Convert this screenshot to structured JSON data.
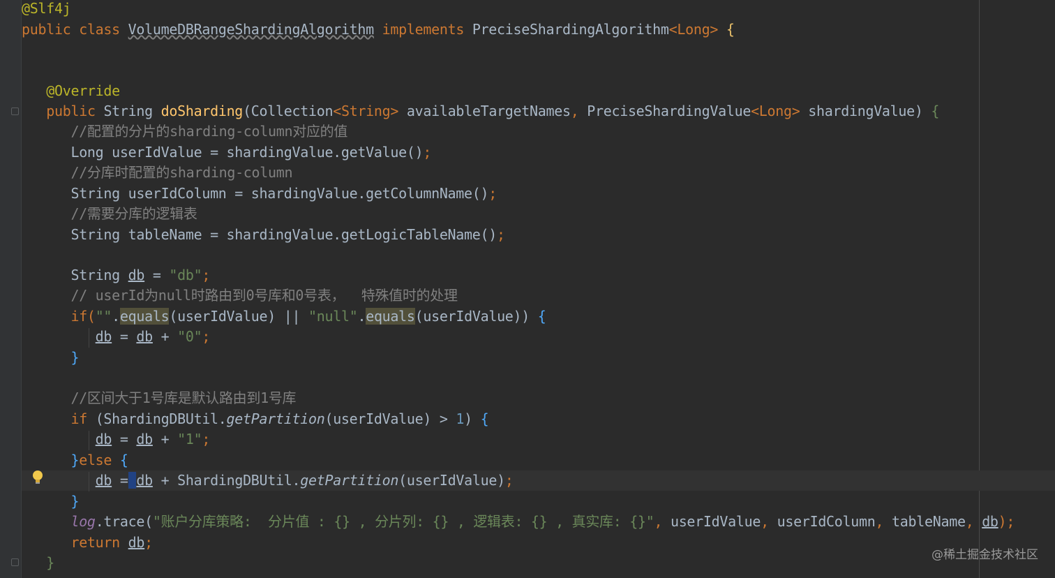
{
  "editor": {
    "theme": "darcula",
    "colors": {
      "background": "#2b2b2b",
      "keyword": "#cc7832",
      "annotation": "#bbb529",
      "string": "#6a8759",
      "number": "#6897bb",
      "comment": "#808080",
      "method": "#ffc66d",
      "text": "#a9b7c6"
    },
    "code": {
      "l1_annotation": "@Slf4j",
      "l2_public": "public",
      "l2_class": "class",
      "l2_classname": "VolumeDBRangeShardingAlgorithm",
      "l2_implements": "implements",
      "l2_iface": "PreciseShardingAlgorithm",
      "l2_generic": "<Long>",
      "l2_brace": "{",
      "l3_override": "@Override",
      "l4_public": "public",
      "l4_type": "String",
      "l4_method": "doSharding",
      "l4_p1": "(Collection",
      "l4_p1gen": "<String>",
      "l4_p1name": "availableTargetNames",
      "l4_comma": ",",
      "l4_p2": "PreciseShardingValue",
      "l4_p2gen": "<Long>",
      "l4_p2name": "shardingValue)",
      "l4_brace": "{",
      "c1": "//配置的分片的sharding-column对应的值",
      "l5_type": "Long",
      "l5_rest": "userIdValue = shardingValue.getValue()",
      "c2": "//分库时配置的sharding-column",
      "l6_type": "String",
      "l6_rest": "userIdColumn = shardingValue.getColumnName()",
      "c3": "//需要分库的逻辑表",
      "l7_type": "String",
      "l7_rest": "tableName = shardingValue.getLogicTableName()",
      "semi": ";",
      "l8_type": "String",
      "l8_var": "db",
      "l8_eq": "=",
      "l8_str": "\"db\"",
      "c4": "// userId为null时路由到0号库和0号表，  特殊值时的处理",
      "l9_if": "if(",
      "l9_str1": "\"\"",
      "l9_dot": ".",
      "l9_equals1": "equals",
      "l9_arg1": "(userIdValue)",
      "l9_or": "||",
      "l9_str2": "\"null\"",
      "l9_equals2": "equals",
      "l9_arg2": "(userIdValue))",
      "l9_brace": "{",
      "l10_db": "db",
      "l10_plus": "+",
      "l10_str": "\"0\"",
      "close_brace": "}",
      "c5": "//区间大于1号库是默认路由到1号库",
      "l11_if": "if",
      "l11_cls": "(ShardingDBUtil.",
      "l11_method": "getPartition",
      "l11_arg": "(userIdValue)",
      "l11_gt": ">",
      "l11_num": "1",
      "l11_paren": ")",
      "l12_str": "\"1\"",
      "l13_else": "else",
      "l14_cls": "ShardingDBUtil.",
      "l14_method": "getPartition",
      "l14_arg": "(userIdValue)",
      "l15_log": "log",
      "l15_trace": ".trace(",
      "l15_str": "\"账户分库策略:  分片值 : {} , 分片列: {} , 逻辑表: {} , 真实库: {}\"",
      "l15_args1": "userIdValue",
      "l15_args2": "userIdColumn",
      "l15_args3": "tableName",
      "l15_db": "db",
      "l15_end": ");",
      "l16_return": "return",
      "l16_db": "db"
    }
  },
  "watermark": "@稀土掘金技术社区"
}
